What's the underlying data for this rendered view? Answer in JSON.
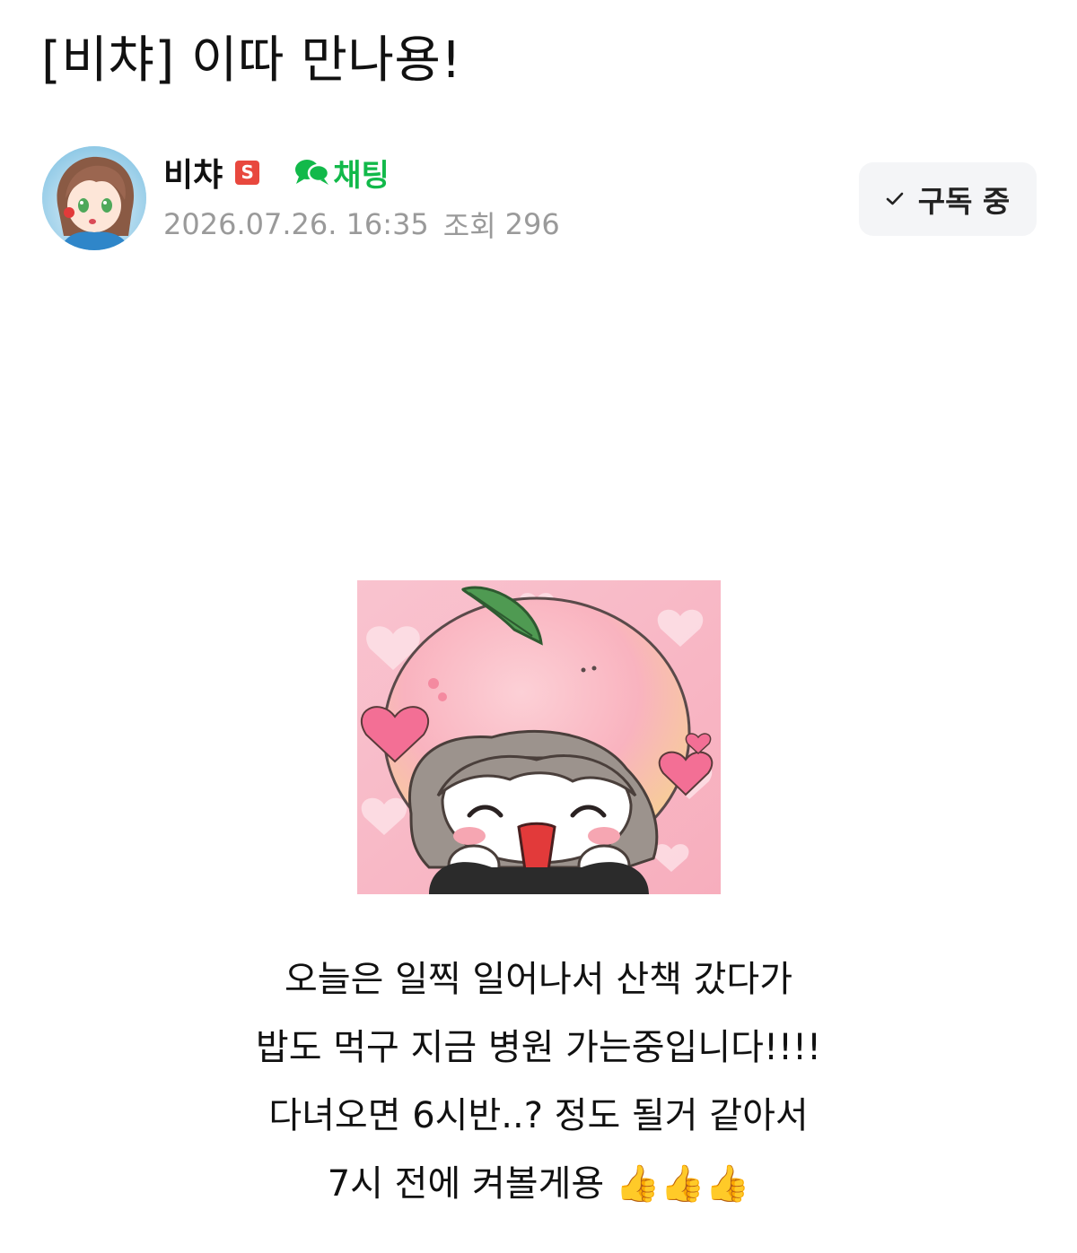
{
  "post": {
    "title": "[비챠] 이따 만나용!",
    "author": {
      "name": "비챠",
      "badge": "S",
      "avatar_icon": "avatar-anime-girl"
    },
    "chat_label": "채팅",
    "date": "2026.07.26. 16:35",
    "views_label": "조회",
    "views": "296",
    "subscribe_label": "구독 중",
    "sticker_icon": "peach-hat-girl-sticker",
    "body_lines": [
      "오늘은 일찍 일어나서 산책 갔다가",
      "밥도 먹구 지금 병원 가는중입니다!!!!",
      "다녀오면 6시반..? 정도 될거 같아서",
      "7시 전에 켜볼게용"
    ],
    "emoji": "👍👍👍"
  },
  "colors": {
    "chat_green": "#12b94a",
    "badge_red": "#e8483e",
    "meta_gray": "#9a9a9a",
    "button_bg": "#f4f5f7"
  }
}
